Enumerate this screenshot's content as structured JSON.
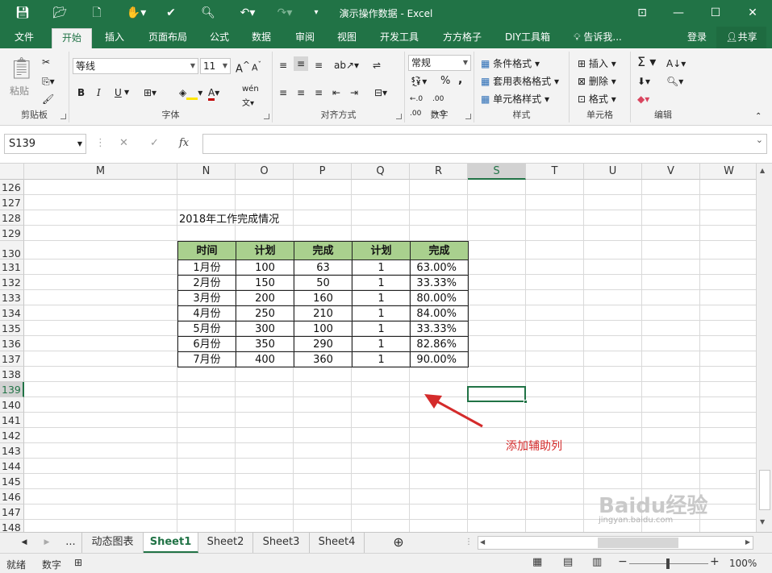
{
  "window": {
    "title": "演示操作数据 - Excel"
  },
  "menu": {
    "tabs": [
      "文件",
      "开始",
      "插入",
      "页面布局",
      "公式",
      "数据",
      "审阅",
      "视图",
      "开发工具",
      "方方格子",
      "DIY工具箱",
      "告诉我..."
    ],
    "login": "登录",
    "share": "共享"
  },
  "ribbon": {
    "clipboard": {
      "label": "剪贴板",
      "paste": "粘贴"
    },
    "font": {
      "label": "字体",
      "font_name": "等线",
      "font_size": "11",
      "bold": "B",
      "italic": "I",
      "underline": "U",
      "text_color": "#c00000",
      "fill_color": "#ffe600",
      "phonetic": "wén"
    },
    "alignment": {
      "label": "对齐方式"
    },
    "number": {
      "label": "数字",
      "format": "常规",
      "percent": "%",
      "comma": ","
    },
    "styles": {
      "label": "样式",
      "conditional": "条件格式",
      "table": "套用表格格式",
      "cell_styles": "单元格样式"
    },
    "cells": {
      "label": "单元格",
      "insert": "插入",
      "delete": "删除",
      "format": "格式"
    },
    "editing": {
      "label": "编辑"
    }
  },
  "formula_bar": {
    "name_box": "S139",
    "cancel": "✕",
    "enter": "✓",
    "fx": "fx",
    "formula": ""
  },
  "columns": [
    "M",
    "N",
    "O",
    "P",
    "Q",
    "R",
    "S",
    "T",
    "U",
    "V",
    "W"
  ],
  "selected_column": "S",
  "rows": [
    "126",
    "127",
    "128",
    "129",
    "130",
    "131",
    "132",
    "133",
    "134",
    "135",
    "136",
    "137",
    "138",
    "139",
    "140",
    "141",
    "142",
    "143",
    "144",
    "145",
    "146",
    "147",
    "148"
  ],
  "selected_row": "139",
  "sheet": {
    "title_cell": "2018年工作完成情况",
    "table": {
      "headers": [
        "时间",
        "计划",
        "完成",
        "计划",
        "完成"
      ],
      "header_fill": "#a9d08e",
      "rows": [
        [
          "1月份",
          "100",
          "63",
          "1",
          "63.00%"
        ],
        [
          "2月份",
          "150",
          "50",
          "1",
          "33.33%"
        ],
        [
          "3月份",
          "200",
          "160",
          "1",
          "80.00%"
        ],
        [
          "4月份",
          "250",
          "210",
          "1",
          "84.00%"
        ],
        [
          "5月份",
          "300",
          "100",
          "1",
          "33.33%"
        ],
        [
          "6月份",
          "350",
          "290",
          "1",
          "82.86%"
        ],
        [
          "7月份",
          "400",
          "360",
          "1",
          "90.00%"
        ]
      ]
    },
    "annotation": "添加辅助列",
    "annotation_color": "#d42b2b"
  },
  "sheet_tabs": {
    "ellipsis": "...",
    "tabs": [
      "动态图表",
      "Sheet1",
      "Sheet2",
      "Sheet3",
      "Sheet4"
    ],
    "active": "Sheet1",
    "add": "⊕"
  },
  "status": {
    "ready": "就绪",
    "numlock": "数字",
    "zoom": "100%"
  },
  "watermark": {
    "text": "Baidu经验",
    "sub": "jingyan.baidu.com"
  }
}
